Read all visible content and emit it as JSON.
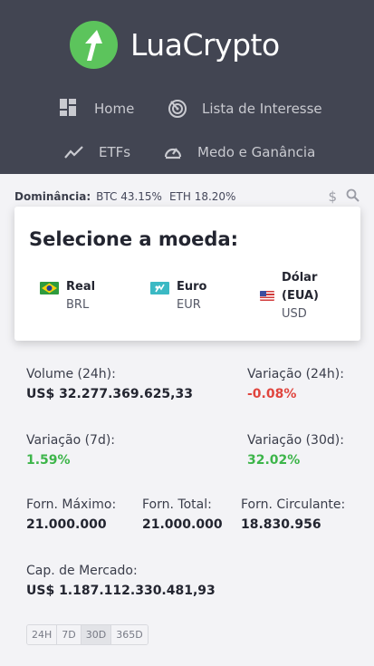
{
  "brand": {
    "name": "LuaCrypto",
    "logo_color": "#5cc45c"
  },
  "nav": [
    {
      "label": "Home",
      "icon": "dashboard-icon"
    },
    {
      "label": "Lista de Interesse",
      "icon": "radar-icon"
    },
    {
      "label": "ETFs",
      "icon": "trend-icon"
    },
    {
      "label": "Medo e Ganância",
      "icon": "gauge-icon"
    }
  ],
  "dominance": {
    "label": "Dominância:",
    "btc": "BTC 43.15%",
    "eth": "ETH 18.20%"
  },
  "toolbar": {
    "dollar": "$"
  },
  "currency_popup": {
    "title": "Selecione a moeda:",
    "options": [
      {
        "name": "Real",
        "code": "BRL",
        "flag": "brazil-flag"
      },
      {
        "name": "Euro",
        "code": "EUR",
        "flag": "eu-flag"
      },
      {
        "name": "Dólar (EUA)",
        "name_line1": "Dólar",
        "name_line2": "(EUA)",
        "code": "USD",
        "flag": "us-flag"
      }
    ]
  },
  "stats": {
    "volume": {
      "label": "Volume (24h):",
      "value": "US$ 32.277.369.625,33"
    },
    "change_24h": {
      "label": "Variação (24h):",
      "value": "-0.08%"
    },
    "change_7d": {
      "label": "Variação (7d):",
      "value": "1.59%"
    },
    "change_30d": {
      "label": "Variação (30d):",
      "value": "32.02%"
    },
    "max_supply": {
      "label": "Forn. Máximo:",
      "value": "21.000.000"
    },
    "total_supply": {
      "label": "Forn. Total:",
      "value": "21.000.000"
    },
    "circ_supply": {
      "label": "Forn. Circulante:",
      "value": "18.830.956"
    },
    "market_cap": {
      "label": "Cap. de Mercado:",
      "value": "US$ 1.187.112.330.481,93"
    }
  },
  "ranges": [
    "24H",
    "7D",
    "30D",
    "365D"
  ],
  "active_range": "30D",
  "colors": {
    "header": "#424552",
    "negative": "#e0453e",
    "positive": "#3db54a"
  }
}
